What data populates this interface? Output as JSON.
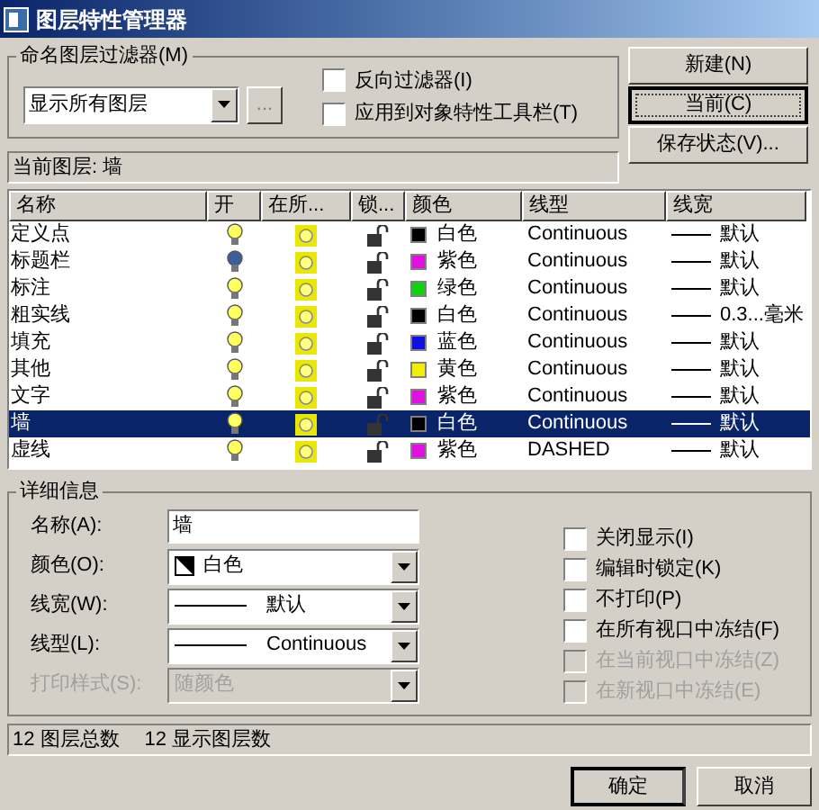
{
  "window": {
    "title": "图层特性管理器"
  },
  "filter": {
    "group_label": "命名图层过滤器(M)",
    "value": "显示所有图层",
    "browse": "...",
    "options": [
      {
        "label": "反向过滤器(I)",
        "checked": false
      },
      {
        "label": "应用到对象特性工具栏(T)",
        "checked": false
      }
    ]
  },
  "side_buttons": [
    {
      "label": "新建(N)",
      "focused": false
    },
    {
      "label": "当前(C)",
      "focused": true
    },
    {
      "label": "保存状态(V)...",
      "focused": false
    }
  ],
  "current_layer": "当前图层: 墙",
  "table": {
    "columns": [
      "名称",
      "开",
      "在所...",
      "锁...",
      "颜色",
      "线型",
      "线宽"
    ],
    "rows": [
      {
        "name": "定义点",
        "on": true,
        "locked": false,
        "color_name": "白色",
        "color": "#000000",
        "linetype": "Continuous",
        "lineweight": "默认",
        "selected": false
      },
      {
        "name": "标题栏",
        "on": false,
        "locked": false,
        "color_name": "紫色",
        "color": "#e010e0",
        "linetype": "Continuous",
        "lineweight": "默认",
        "selected": false
      },
      {
        "name": "标注",
        "on": true,
        "locked": false,
        "color_name": "绿色",
        "color": "#10d010",
        "linetype": "Continuous",
        "lineweight": "默认",
        "selected": false
      },
      {
        "name": "粗实线",
        "on": true,
        "locked": false,
        "color_name": "白色",
        "color": "#000000",
        "linetype": "Continuous",
        "lineweight": "0.3...毫米",
        "selected": false
      },
      {
        "name": "填充",
        "on": true,
        "locked": false,
        "color_name": "蓝色",
        "color": "#1010e0",
        "linetype": "Continuous",
        "lineweight": "默认",
        "selected": false
      },
      {
        "name": "其他",
        "on": true,
        "locked": false,
        "color_name": "黄色",
        "color": "#f0f000",
        "linetype": "Continuous",
        "lineweight": "默认",
        "selected": false
      },
      {
        "name": "文字",
        "on": true,
        "locked": false,
        "color_name": "紫色",
        "color": "#e010e0",
        "linetype": "Continuous",
        "lineweight": "默认",
        "selected": false
      },
      {
        "name": "墙",
        "on": true,
        "locked": false,
        "color_name": "白色",
        "color": "#000000",
        "linetype": "Continuous",
        "lineweight": "默认",
        "selected": true
      },
      {
        "name": "虚线",
        "on": true,
        "locked": false,
        "color_name": "紫色",
        "color": "#e010e0",
        "linetype": "DASHED",
        "lineweight": "默认",
        "selected": false
      }
    ]
  },
  "details": {
    "group_label": "详细信息",
    "fields": [
      {
        "kind": "text",
        "label": "名称(A):",
        "value": "墙",
        "disabled": false
      },
      {
        "kind": "color",
        "label": "颜色(O):",
        "value": "白色",
        "disabled": false
      },
      {
        "kind": "line",
        "label": "线宽(W):",
        "value": "默认",
        "disabled": false
      },
      {
        "kind": "line",
        "label": "线型(L):",
        "value": "Continuous",
        "disabled": false
      },
      {
        "kind": "plain",
        "label": "打印样式(S):",
        "value": "随颜色",
        "disabled": true
      }
    ],
    "options": [
      {
        "label": "关闭显示(I)",
        "checked": false,
        "disabled": false
      },
      {
        "label": "编辑时锁定(K)",
        "checked": false,
        "disabled": false
      },
      {
        "label": "不打印(P)",
        "checked": false,
        "disabled": false
      },
      {
        "label": "在所有视口中冻结(F)",
        "checked": false,
        "disabled": false
      },
      {
        "label": "在当前视口中冻结(Z)",
        "checked": false,
        "disabled": true
      },
      {
        "label": "在新视口中冻结(E)",
        "checked": false,
        "disabled": true
      }
    ]
  },
  "status_bar": [
    "12 图层总数",
    "12 显示图层数"
  ],
  "buttons": [
    {
      "label": "确定",
      "focused": true
    },
    {
      "label": "取消",
      "focused": false
    }
  ]
}
